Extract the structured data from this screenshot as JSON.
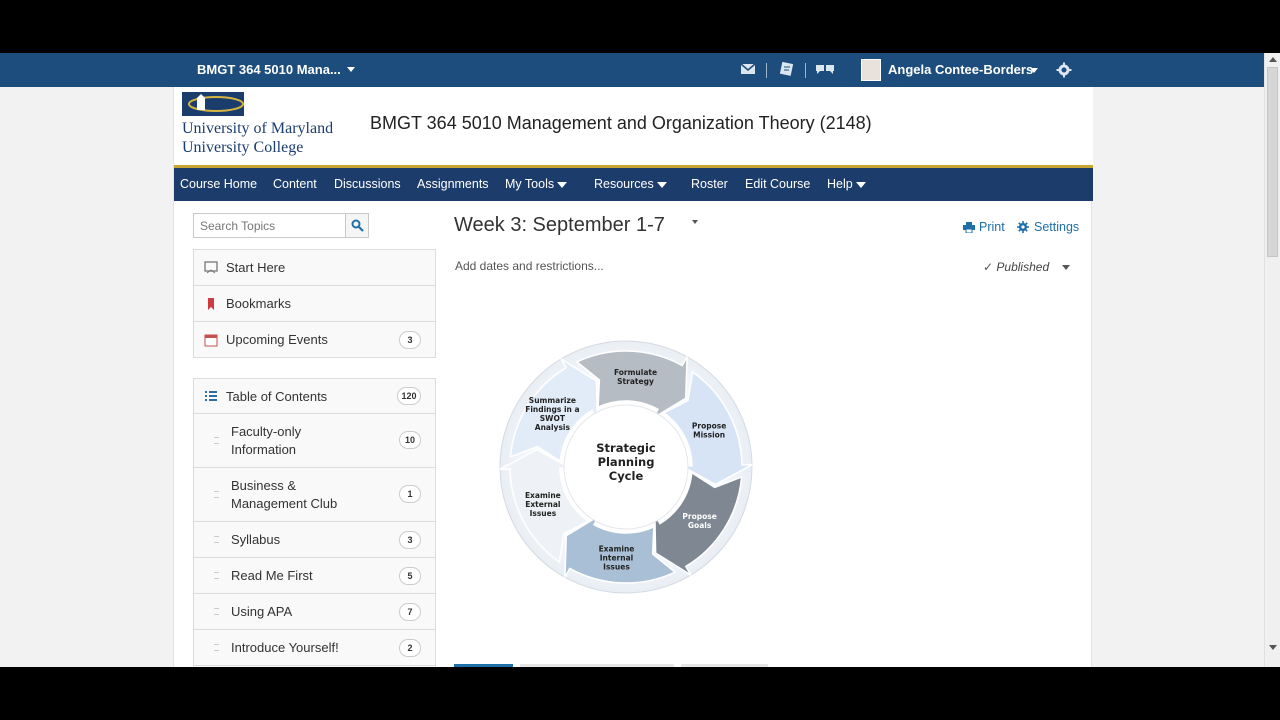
{
  "navbar": {
    "course_selector": "BMGT 364 5010 Mana...",
    "user_name": "Angela Contee-Borders"
  },
  "banner": {
    "logo_line1": "University of Maryland",
    "logo_line2": "University College",
    "course_title": "BMGT 364 5010 Management and Organization Theory (2148)"
  },
  "course_nav": [
    {
      "label": "Course Home"
    },
    {
      "label": "Content"
    },
    {
      "label": "Discussions"
    },
    {
      "label": "Assignments"
    },
    {
      "label": "My Tools"
    },
    {
      "label": "Resources"
    },
    {
      "label": "Roster"
    },
    {
      "label": "Edit Course"
    },
    {
      "label": "Help"
    }
  ],
  "sidebar": {
    "search_placeholder": "Search Topics",
    "top_items": [
      {
        "label": "Start Here",
        "icon": "start-here-icon"
      },
      {
        "label": "Bookmarks",
        "icon": "bookmark-icon"
      },
      {
        "label": "Upcoming Events",
        "icon": "calendar-icon",
        "count": "3"
      }
    ],
    "toc": {
      "label": "Table of Contents",
      "count": "120"
    },
    "toc_items": [
      {
        "label": "Faculty-only Information",
        "count": "10"
      },
      {
        "label": "Business & Management Club",
        "count": "1"
      },
      {
        "label": "Syllabus",
        "count": "3"
      },
      {
        "label": "Read Me First",
        "count": "5"
      },
      {
        "label": "Using APA",
        "count": "7"
      },
      {
        "label": "Introduce Yourself!",
        "count": "2"
      }
    ]
  },
  "main": {
    "week_title": "Week 3: September 1-7",
    "print_label": "Print",
    "settings_label": "Settings",
    "add_dates": "Add dates and restrictions...",
    "published": "Published"
  },
  "diagram": {
    "center": [
      "Strategic",
      "Planning",
      "Cycle"
    ],
    "steps": [
      {
        "lines": [
          "Formulate",
          "Strategy"
        ]
      },
      {
        "lines": [
          "Propose",
          "Mission"
        ]
      },
      {
        "lines": [
          "Propose",
          "Goals"
        ]
      },
      {
        "lines": [
          "Examine",
          "Internal",
          "Issues"
        ]
      },
      {
        "lines": [
          "Examine",
          "External",
          "Issues"
        ]
      },
      {
        "lines": [
          "Summarize",
          "Findings in a",
          "SWOT",
          "Analysis"
        ]
      }
    ]
  },
  "colors": {
    "navbar": "#1c4d7c",
    "course_nav": "#1c3d6b",
    "gold_rule": "#c9a534",
    "link": "#1e6fa8"
  }
}
